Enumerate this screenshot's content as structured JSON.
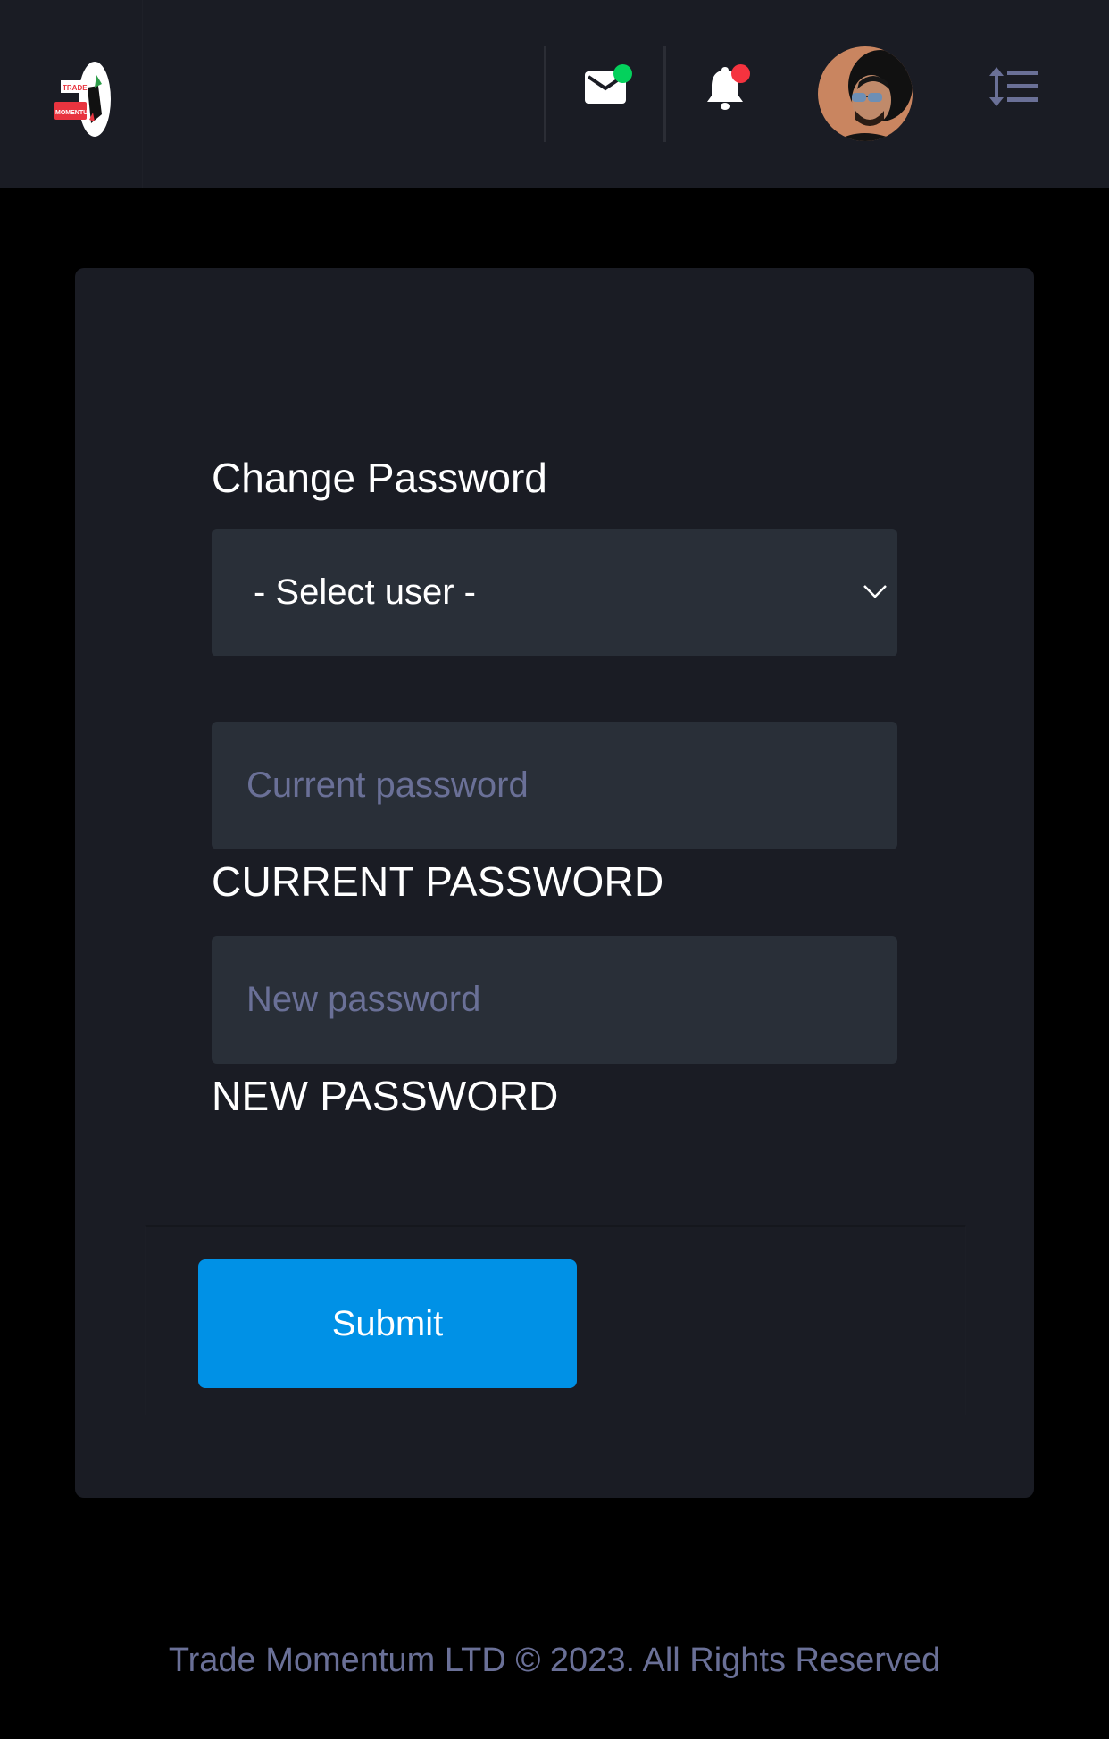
{
  "header": {
    "logo_alt": "Trade Momentum logo",
    "logo_text_top": "TRADE",
    "logo_text_bottom": "MOMENTUM",
    "mail_icon": "envelope-icon",
    "mail_badge_color": "#04d15c",
    "bell_icon": "bell-icon",
    "bell_badge_color": "#f5333f",
    "avatar_label": "User avatar",
    "menu_icon": "line-height-menu-icon"
  },
  "form": {
    "title": "Change Password",
    "user_select": {
      "selected": "- Select user -",
      "options": [
        "- Select user -"
      ]
    },
    "current_password": {
      "placeholder": "Current password",
      "value": "",
      "label": "CURRENT PASSWORD"
    },
    "new_password": {
      "placeholder": "New password",
      "value": "",
      "label": "NEW PASSWORD"
    },
    "submit_label": "Submit"
  },
  "colors": {
    "accent": "#0091e6",
    "card_bg": "#1a1c24",
    "input_bg": "#292f38",
    "muted_text": "#6a7097"
  },
  "footer": {
    "copyright": "Trade Momentum LTD © 2023. All Rights Reserved"
  }
}
